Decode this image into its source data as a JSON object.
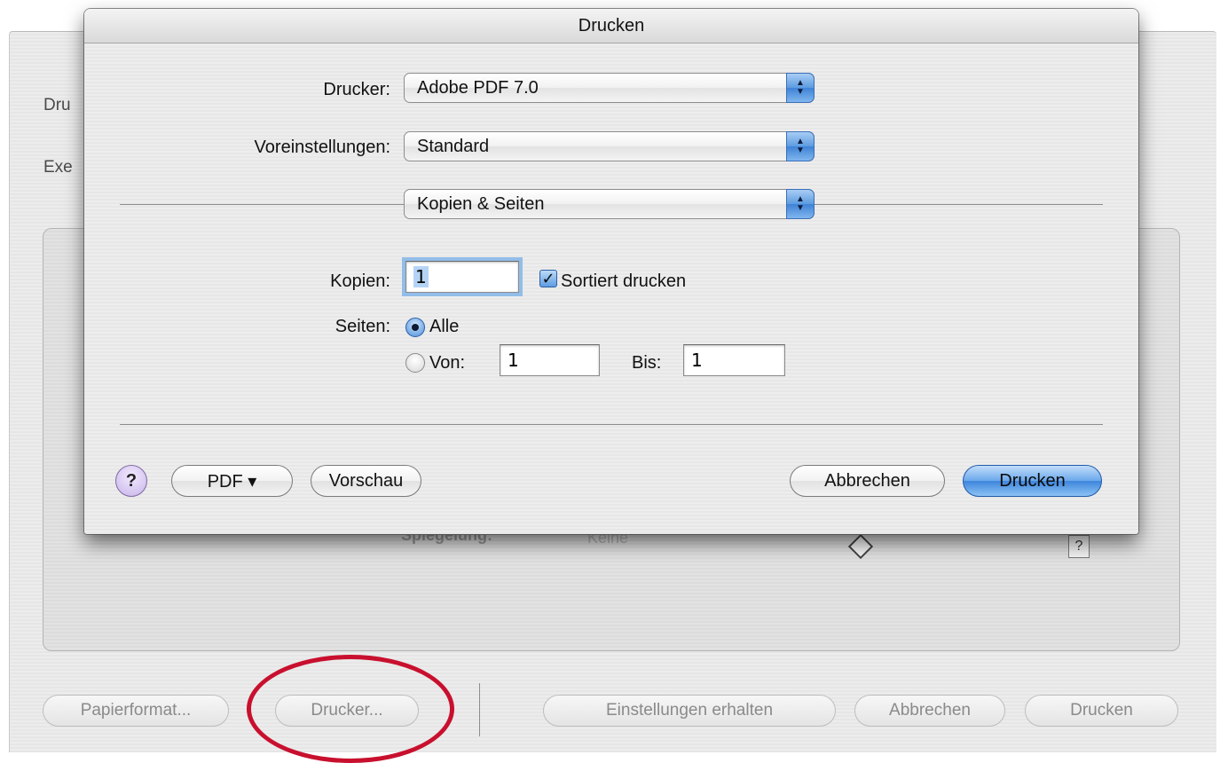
{
  "background_window": {
    "label_drucker_partial": "Dru",
    "label_exemplare_partial": "Exe",
    "faint_label": "Spiegelung:",
    "faint_value": "Keine",
    "help_square": "?",
    "buttons": {
      "papierformat": "Papierformat...",
      "drucker": "Drucker...",
      "einstellungen": "Einstellungen erhalten",
      "abbrechen": "Abbrechen",
      "drucken": "Drucken"
    },
    "highlight_color": "#c8102e"
  },
  "dialog": {
    "title": "Drucken",
    "printer": {
      "label": "Drucker:",
      "value": "Adobe PDF 7.0"
    },
    "presets": {
      "label": "Voreinstellungen:",
      "value": "Standard"
    },
    "panel": {
      "value": "Kopien & Seiten"
    },
    "copies": {
      "label": "Kopien:",
      "value": "1"
    },
    "collate": {
      "label": "Sortiert drucken",
      "checked": true,
      "mark": "✓"
    },
    "pages": {
      "label": "Seiten:",
      "all_label": "Alle",
      "all_selected": true,
      "from_label": "Von:",
      "from_value": "1",
      "to_label": "Bis:",
      "to_value": "1"
    },
    "footer": {
      "help": "?",
      "pdf": "PDF ▾",
      "preview": "Vorschau",
      "cancel": "Abbrechen",
      "print": "Drucken"
    },
    "accent_color": "#3d85dc",
    "popup_arrows": {
      "up": "▲",
      "down": "▼"
    }
  }
}
